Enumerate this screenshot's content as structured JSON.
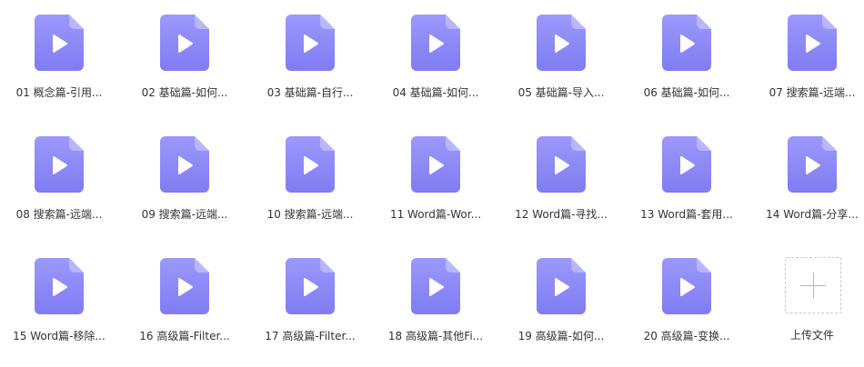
{
  "files": [
    {
      "label": "01 概念篇-引用..."
    },
    {
      "label": "02 基础篇-如何..."
    },
    {
      "label": "03 基础篇-自行..."
    },
    {
      "label": "04 基础篇-如何..."
    },
    {
      "label": "05 基础篇-导入..."
    },
    {
      "label": "06 基础篇-如何..."
    },
    {
      "label": "07 搜索篇-远端..."
    },
    {
      "label": "08 搜索篇-远端..."
    },
    {
      "label": "09 搜索篇-远端..."
    },
    {
      "label": "10 搜索篇-远端..."
    },
    {
      "label": "11 Word篇-Wor..."
    },
    {
      "label": "12 Word篇-寻找..."
    },
    {
      "label": "13 Word篇-套用..."
    },
    {
      "label": "14 Word篇-分享..."
    },
    {
      "label": "15 Word篇-移除..."
    },
    {
      "label": "16 高级篇-Filter..."
    },
    {
      "label": "17 高级篇-Filter..."
    },
    {
      "label": "18 高级篇-其他Fi..."
    },
    {
      "label": "19 高级篇-如何..."
    },
    {
      "label": "20 高级篇-变换..."
    }
  ],
  "upload": {
    "label": "上传文件"
  },
  "icon": {
    "name": "video-file-icon",
    "color_top": "#9c98fb",
    "color_bottom": "#7f7cf2",
    "fold": "#b9b6fd",
    "play": "#ffffff"
  }
}
